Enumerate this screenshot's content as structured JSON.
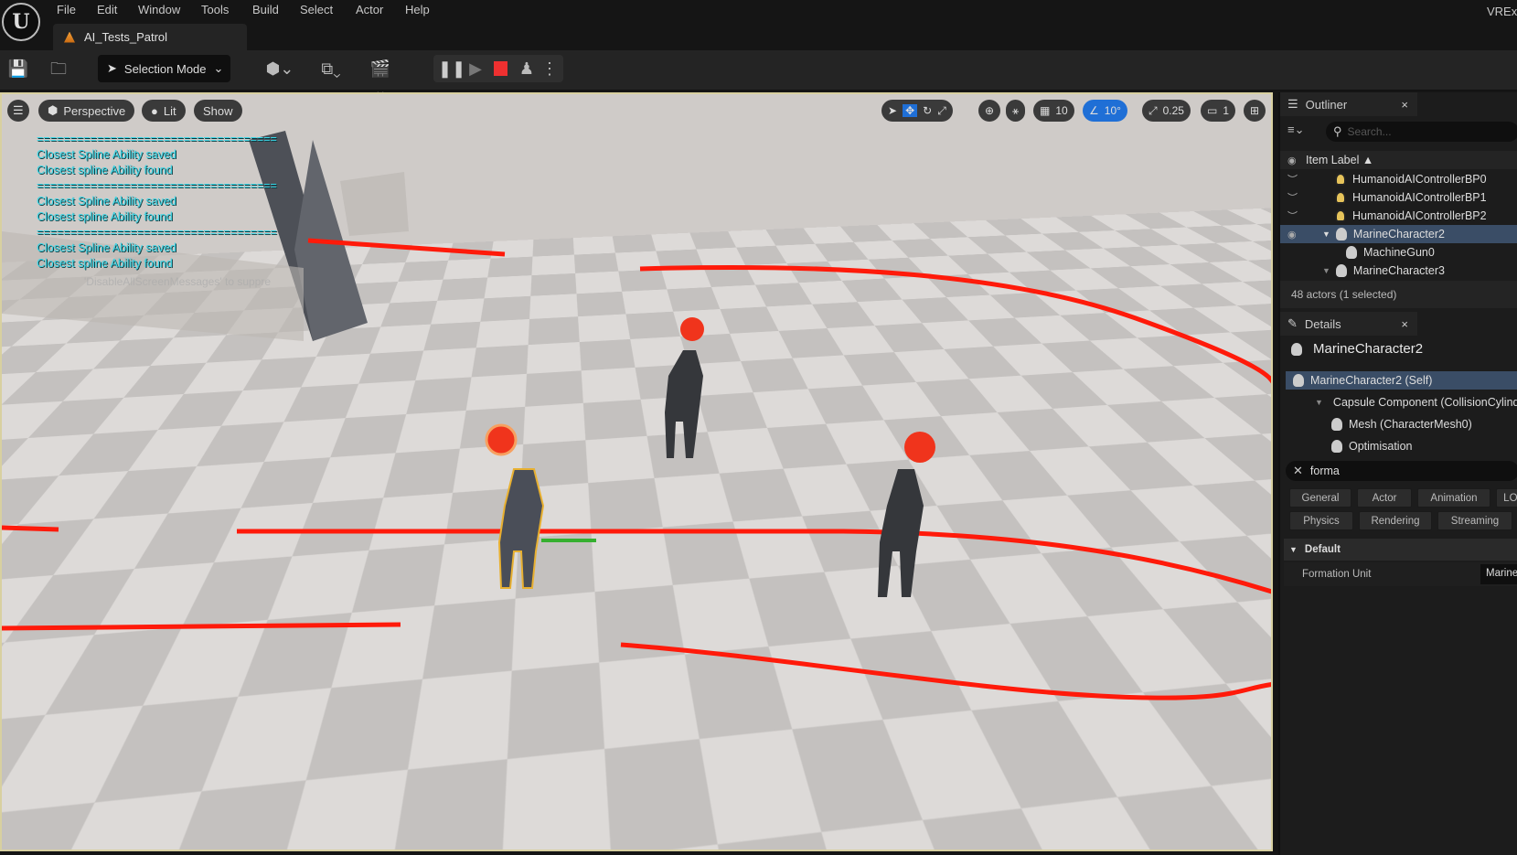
{
  "menubar": {
    "items": [
      "File",
      "Edit",
      "Window",
      "Tools",
      "Build",
      "Select",
      "Actor",
      "Help"
    ],
    "project": "VRExp"
  },
  "tab": {
    "title": "AI_Tests_Patrol"
  },
  "toolbar": {
    "selection_mode": "Selection Mode"
  },
  "viewport": {
    "perspective": "Perspective",
    "lit": "Lit",
    "show": "Show",
    "grid_snap": "10",
    "rotation_snap": "10°",
    "scale_snap": "0.25",
    "camera_speed": "1",
    "debug_messages": [
      "====================================",
      "Closest Spline Ability saved",
      "Closest spline Ability found",
      "====================================",
      "Closest Spline Ability saved",
      "Closest spline Ability found",
      "====================================",
      "Closest Spline Ability saved",
      "Closest spline Ability found"
    ],
    "suppress_hint": "'DisableAllScreenMessages' to suppre"
  },
  "outliner": {
    "title": "Outliner",
    "search_placeholder": "Search...",
    "column": "Item Label ▲",
    "items": [
      {
        "label": "HumanoidAIControllerBP0"
      },
      {
        "label": "HumanoidAIControllerBP1"
      },
      {
        "label": "HumanoidAIControllerBP2"
      },
      {
        "label": "MarineCharacter2",
        "selected": true
      },
      {
        "label": "MachineGun0"
      },
      {
        "label": "MarineCharacter3"
      }
    ],
    "footer": "48 actors (1 selected)"
  },
  "details": {
    "title": "Details",
    "actor": "MarineCharacter2",
    "components": [
      "MarineCharacter2 (Self)",
      "Capsule Component (CollisionCylinder)",
      "Mesh (CharacterMesh0)",
      "Optimisation"
    ],
    "search_value": "forma",
    "filters_row1": [
      "General",
      "Actor",
      "Animation",
      "LOD"
    ],
    "filters_row2": [
      "Physics",
      "Rendering",
      "Streaming"
    ],
    "section": "Default",
    "property": "Formation Unit",
    "property_value": "Marine"
  },
  "colors": {
    "accent": "#1f6fd6",
    "spline": "#ff1a0a",
    "debug_text": "#3ad6e6",
    "selected_row": "#3a4d66"
  }
}
